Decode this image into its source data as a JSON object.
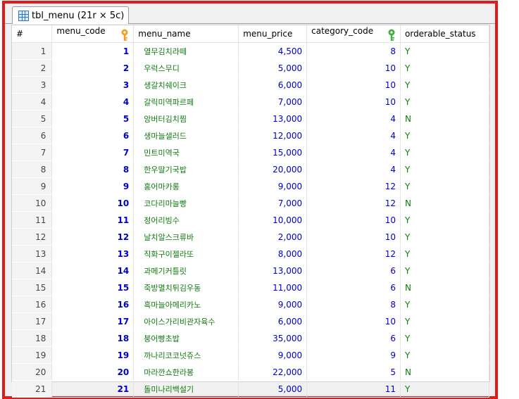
{
  "tab": {
    "title": "tbl_menu (21r × 5c)"
  },
  "table": {
    "columns": [
      "#",
      "menu_code",
      "menu_name",
      "menu_price",
      "category_code",
      "orderable_status"
    ],
    "key_colors": {
      "menu_code": "#f0a020",
      "category_code": "#40b040"
    },
    "rows": [
      {
        "num": "1",
        "code": "1",
        "name": "열무김치라떼",
        "price": "4,500",
        "cat": "8",
        "status": "Y"
      },
      {
        "num": "2",
        "code": "2",
        "name": "우럭스무디",
        "price": "5,000",
        "cat": "10",
        "status": "Y"
      },
      {
        "num": "3",
        "code": "3",
        "name": "생갈치쉐이크",
        "price": "6,000",
        "cat": "10",
        "status": "Y"
      },
      {
        "num": "4",
        "code": "4",
        "name": "갈릭미역파르페",
        "price": "7,000",
        "cat": "10",
        "status": "Y"
      },
      {
        "num": "5",
        "code": "5",
        "name": "앙버터김치찜",
        "price": "13,000",
        "cat": "4",
        "status": "N"
      },
      {
        "num": "6",
        "code": "6",
        "name": "생마늘샐러드",
        "price": "12,000",
        "cat": "4",
        "status": "Y"
      },
      {
        "num": "7",
        "code": "7",
        "name": "민트미역국",
        "price": "15,000",
        "cat": "4",
        "status": "Y"
      },
      {
        "num": "8",
        "code": "8",
        "name": "한우딸기국밥",
        "price": "20,000",
        "cat": "4",
        "status": "Y"
      },
      {
        "num": "9",
        "code": "9",
        "name": "홍어마카롱",
        "price": "9,000",
        "cat": "12",
        "status": "Y"
      },
      {
        "num": "10",
        "code": "10",
        "name": "코다리마늘빵",
        "price": "7,000",
        "cat": "12",
        "status": "N"
      },
      {
        "num": "11",
        "code": "11",
        "name": "정어리빙수",
        "price": "10,000",
        "cat": "10",
        "status": "Y"
      },
      {
        "num": "12",
        "code": "12",
        "name": "날치알스크류바",
        "price": "2,000",
        "cat": "10",
        "status": "Y"
      },
      {
        "num": "13",
        "code": "13",
        "name": "직화구이젤라또",
        "price": "8,000",
        "cat": "12",
        "status": "Y"
      },
      {
        "num": "14",
        "code": "14",
        "name": "과메기커틀릿",
        "price": "13,000",
        "cat": "6",
        "status": "Y"
      },
      {
        "num": "15",
        "code": "15",
        "name": "죽방멸치튀김우동",
        "price": "11,000",
        "cat": "6",
        "status": "N"
      },
      {
        "num": "16",
        "code": "16",
        "name": "흑마늘아메리카노",
        "price": "9,000",
        "cat": "8",
        "status": "Y"
      },
      {
        "num": "17",
        "code": "17",
        "name": "아이스가리비관자육수",
        "price": "6,000",
        "cat": "10",
        "status": "Y"
      },
      {
        "num": "18",
        "code": "18",
        "name": "붕어빵초밥",
        "price": "35,000",
        "cat": "6",
        "status": "Y"
      },
      {
        "num": "19",
        "code": "19",
        "name": "까나리코코넛쥬스",
        "price": "9,000",
        "cat": "9",
        "status": "Y"
      },
      {
        "num": "20",
        "code": "20",
        "name": "마라깐쇼한라봉",
        "price": "22,000",
        "cat": "5",
        "status": "N"
      },
      {
        "num": "21",
        "code": "21",
        "name": "돌미나리백설기",
        "price": "5,000",
        "cat": "11",
        "status": "Y"
      }
    ]
  }
}
